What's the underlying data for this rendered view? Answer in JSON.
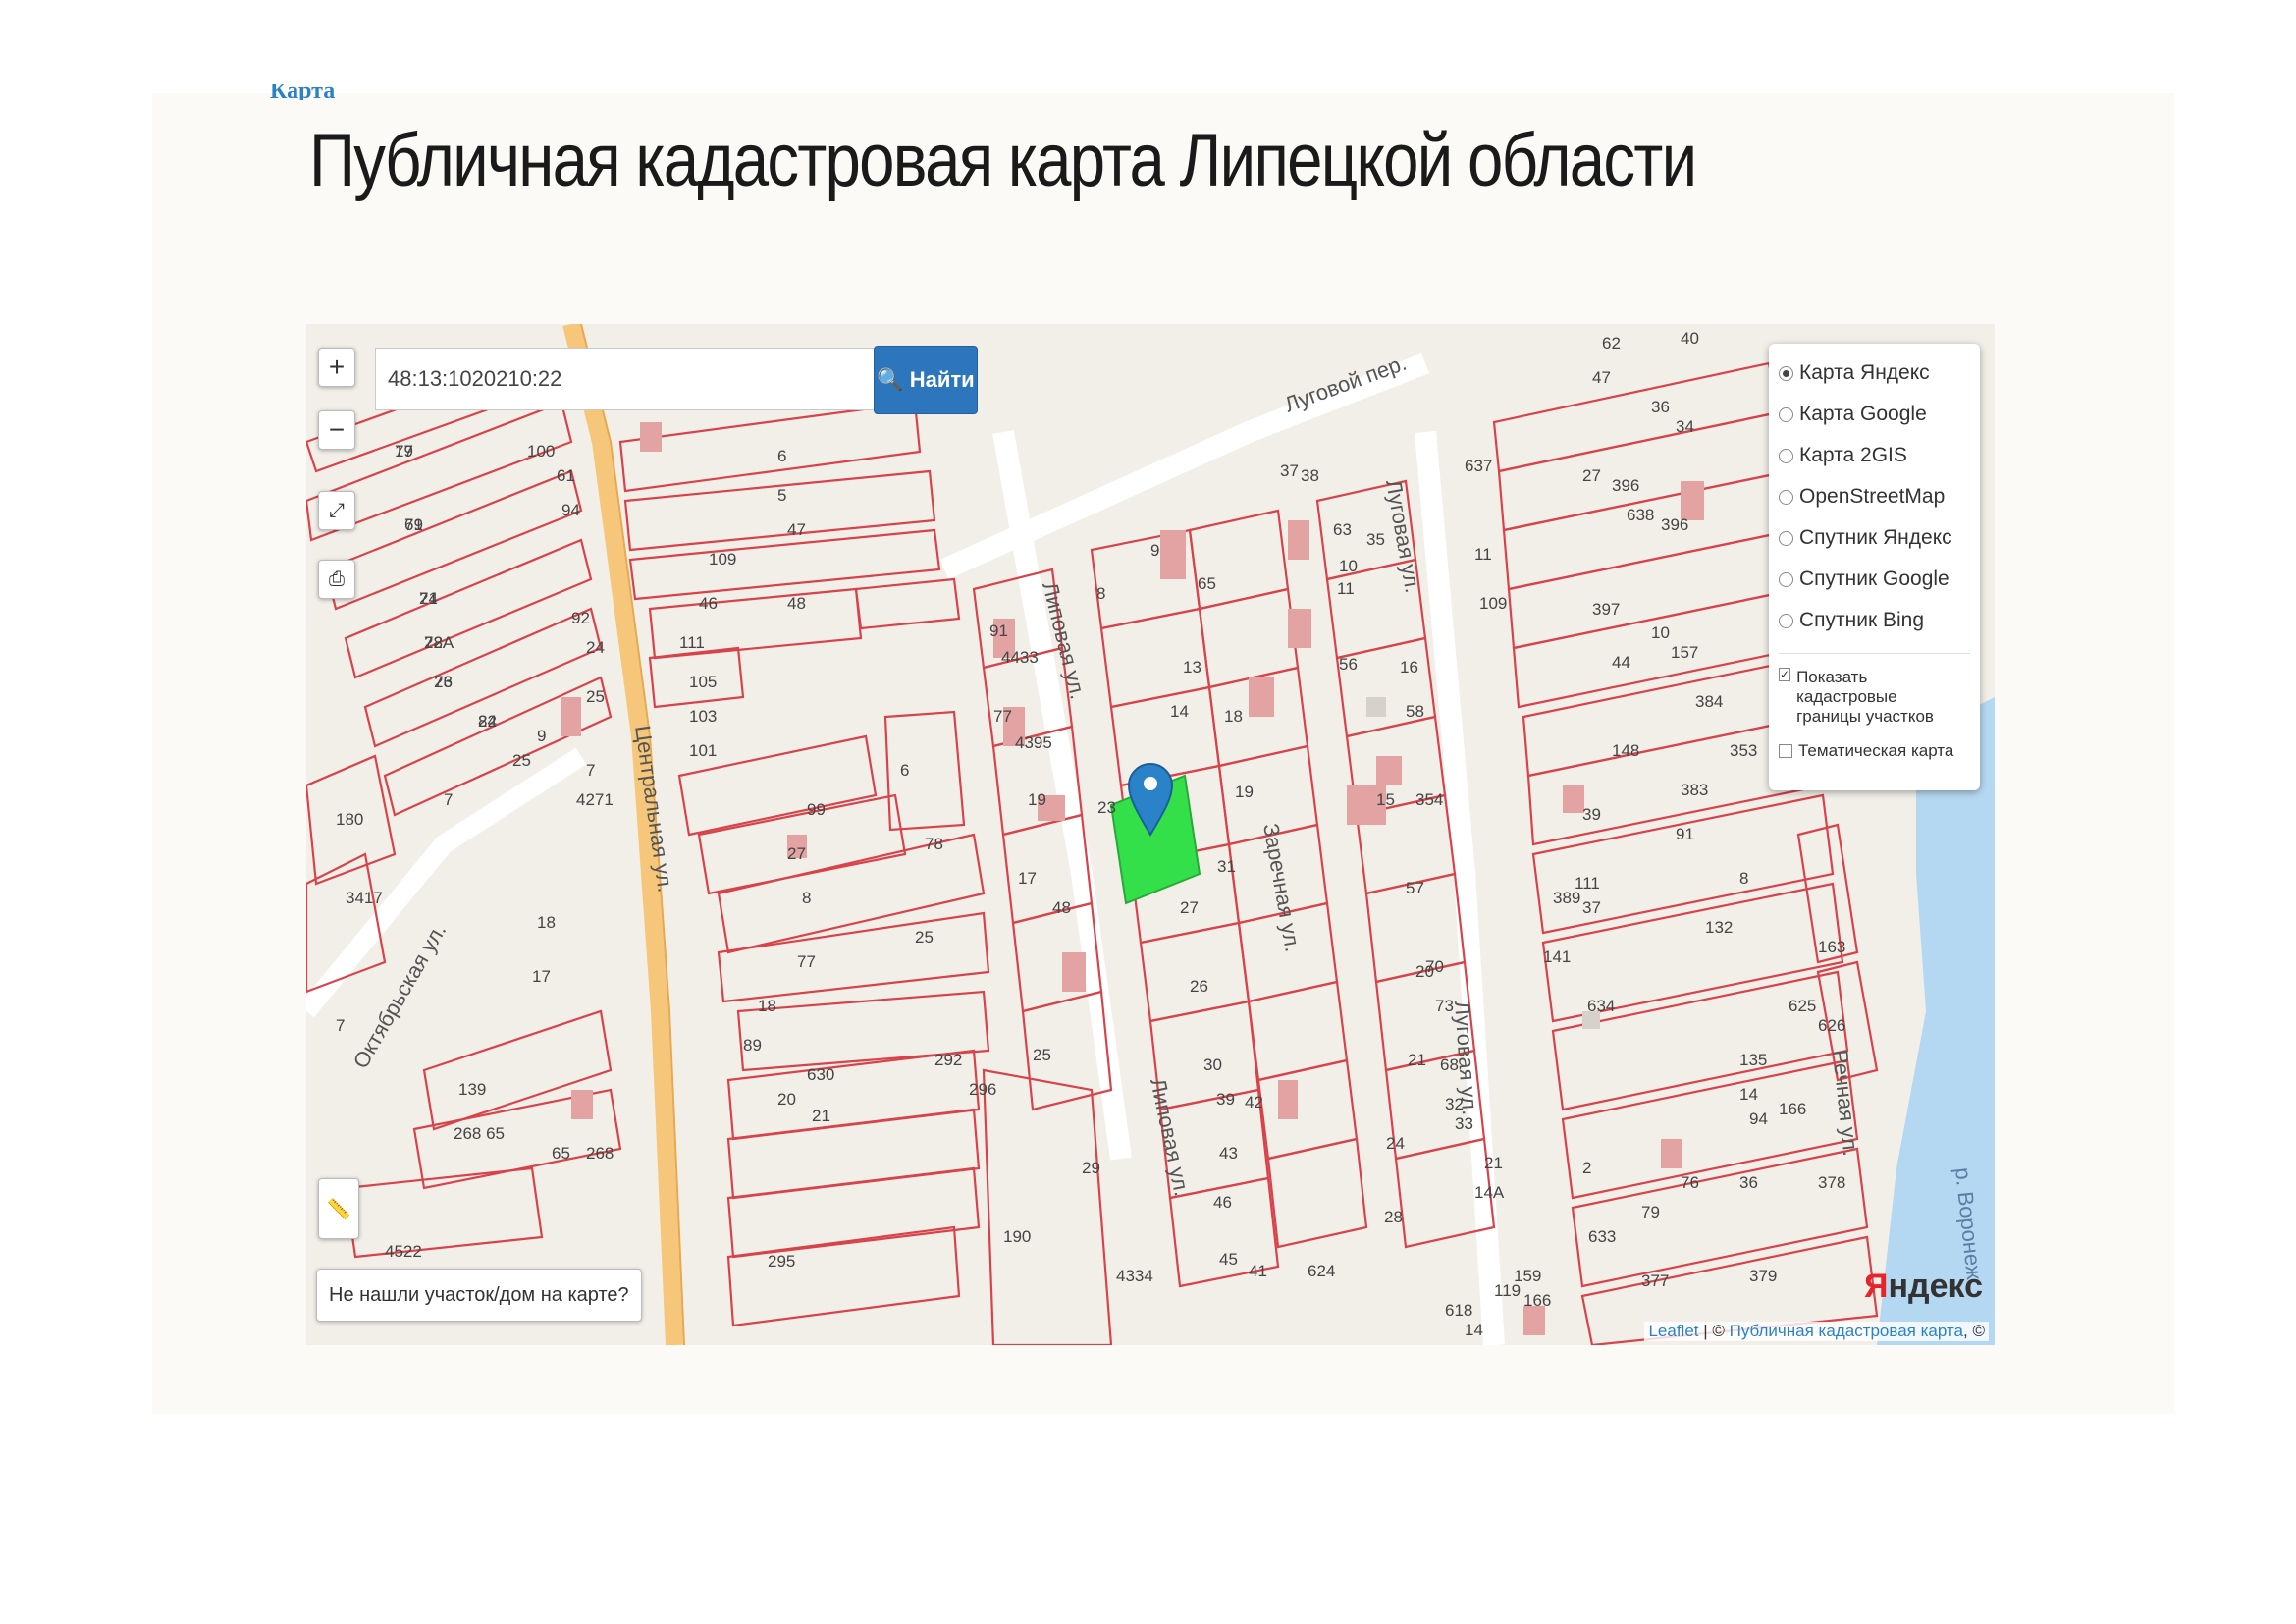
{
  "breadcrumb": "Карта",
  "page_title": "Публичная кадастровая карта Липецкой области",
  "search": {
    "value": "48:13:1020210:22",
    "button_label": "Найти"
  },
  "controls": {
    "zoom_in": "+",
    "zoom_out": "−"
  },
  "layers": {
    "base": [
      {
        "label": "Карта Яндекс",
        "selected": true
      },
      {
        "label": "Карта Google",
        "selected": false
      },
      {
        "label": "Карта 2GIS",
        "selected": false
      },
      {
        "label": "OpenStreetMap",
        "selected": false
      },
      {
        "label": "Спутник Яндекс",
        "selected": false
      },
      {
        "label": "Спутник Google",
        "selected": false
      },
      {
        "label": "Спутник Bing",
        "selected": false
      }
    ],
    "overlays": [
      {
        "label": "Показать кадастровые границы участков",
        "checked": true
      },
      {
        "label": "Тематическая карта",
        "checked": false
      }
    ]
  },
  "not_found_button": "Не нашли участок/дом на карте?",
  "attribution": {
    "leaflet": "Leaflet",
    "separator": " | © ",
    "source": "Публичная кадастровая карта",
    "suffix": ", ©"
  },
  "yandex_logo": {
    "first": "Я",
    "rest": "ндекс"
  },
  "map_labels": {
    "streets": [
      "Центральная ул.",
      "Липовая ул.",
      "Липовая ул.",
      "Заречная ул.",
      "Луговая ул.",
      "Луговая ул.",
      "Луговой пер.",
      "Октябрьская ул.",
      "Речная ул.",
      "р. Воронеж"
    ],
    "plots": [
      "19",
      "61",
      "21",
      "28",
      "23",
      "24",
      "25",
      "9",
      "4271",
      "7",
      "180",
      "3417",
      "18",
      "17",
      "7",
      "139",
      "268 65",
      "268",
      "65",
      "4522",
      "100",
      "61",
      "94",
      "92",
      "24",
      "25",
      "7",
      "6",
      "5",
      "47",
      "48",
      "46",
      "109",
      "111",
      "105",
      "103",
      "101",
      "99",
      "27",
      "6",
      "8",
      "78",
      "77",
      "25",
      "292",
      "296",
      "630",
      "21",
      "20",
      "295",
      "18",
      "89",
      "91",
      "4433",
      "77",
      "4395",
      "19",
      "17",
      "48",
      "25",
      "29",
      "190",
      "4334",
      "9",
      "65",
      "8",
      "13",
      "14",
      "18",
      "19",
      "23",
      "31",
      "27",
      "26",
      "30",
      "39",
      "42",
      "43",
      "46",
      "45",
      "41",
      "37",
      "38",
      "63",
      "35",
      "10",
      "11",
      "56",
      "16",
      "58",
      "15",
      "57",
      "20",
      "21",
      "24",
      "28",
      "62",
      "40",
      "44",
      "47",
      "36",
      "34",
      "637",
      "27",
      "396",
      "638",
      "11",
      "396",
      "109",
      "397",
      "10",
      "44",
      "157",
      "384",
      "148",
      "383",
      "353",
      "354",
      "39",
      "111",
      "91",
      "389",
      "8",
      "37",
      "132",
      "141",
      "634",
      "135",
      "14",
      "94",
      "2",
      "76",
      "36",
      "79",
      "633",
      "377",
      "379",
      "163",
      "378",
      "625",
      "166",
      "626",
      "624",
      "618",
      "119",
      "159",
      "166",
      "14",
      "14A",
      "21",
      "33",
      "32",
      "68",
      "73",
      "70",
      "77",
      "79",
      "74",
      "72A",
      "76",
      "82"
    ]
  },
  "colors": {
    "plot_border": "#d8434b",
    "selected_plot": "#33e04a",
    "marker": "#2a82c9",
    "road": "#f6c77a",
    "water": "#b5d8f2"
  }
}
